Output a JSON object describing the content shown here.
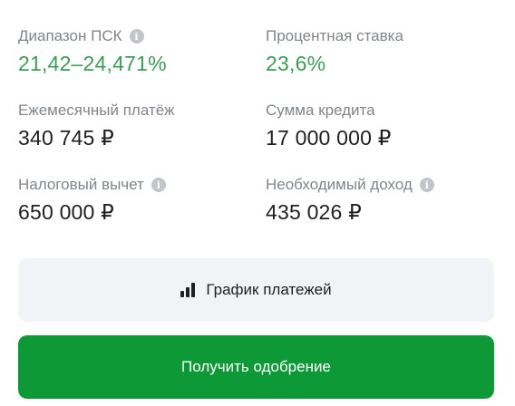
{
  "summary": {
    "psk_range": {
      "label": "Диапазон ПСК",
      "value": "21,42–24,471%",
      "info_icon": "info-icon"
    },
    "interest_rate": {
      "label": "Процентная ставка",
      "value": "23,6%"
    },
    "monthly_payment": {
      "label": "Ежемесячный платёж",
      "value": "340 745 ₽"
    },
    "loan_amount": {
      "label": "Сумма кредита",
      "value": "17 000 000 ₽"
    },
    "tax_deduction": {
      "label": "Налоговый вычет",
      "value": "650 000 ₽",
      "info_icon": "info-icon"
    },
    "required_income": {
      "label": "Необходимый доход",
      "value": "435 026 ₽",
      "info_icon": "info-icon"
    }
  },
  "actions": {
    "schedule_label": "График платежей",
    "schedule_icon": "bar-chart-icon",
    "approve_label": "Получить одобрение"
  },
  "colors": {
    "accent_green": "#3a9e55",
    "primary_button": "#0d9a36",
    "secondary_button": "#f2f3f7",
    "label_gray": "#808589"
  }
}
